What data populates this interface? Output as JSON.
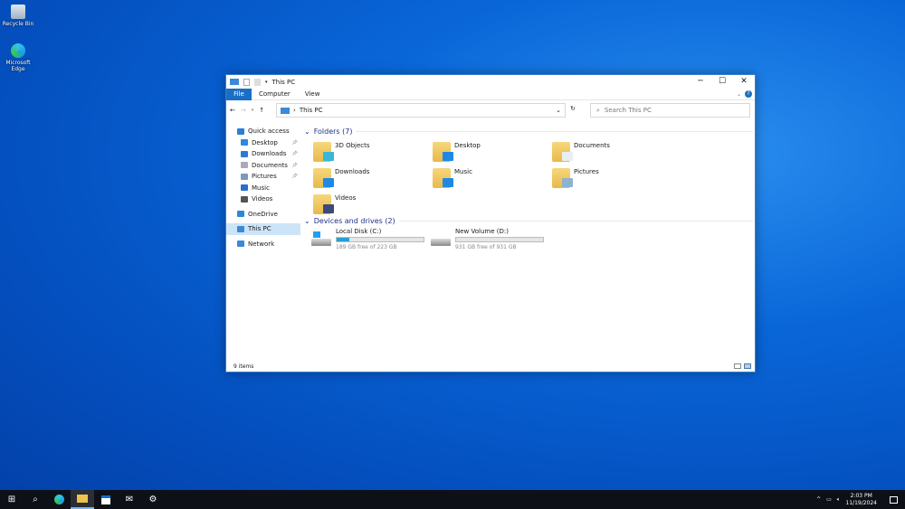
{
  "desktop": {
    "icons": [
      {
        "label": "Recycle Bin",
        "icon": "recycle-bin-icon"
      },
      {
        "label": "Microsoft Edge",
        "icon": "edge-icon"
      }
    ]
  },
  "window": {
    "title": "This PC",
    "controls": {
      "minimize": "─",
      "maximize": "☐",
      "close": "✕"
    },
    "ribbon": {
      "tabs": [
        "File",
        "Computer",
        "View"
      ]
    },
    "address": {
      "path": "This PC",
      "search_placeholder": "Search This PC"
    },
    "nav": {
      "items": [
        {
          "label": "Quick access",
          "color": "#2b7fd4"
        },
        {
          "label": "Desktop",
          "color": "#2a8ae0",
          "pinned": true
        },
        {
          "label": "Downloads",
          "color": "#2a7ad0",
          "pinned": true
        },
        {
          "label": "Documents",
          "color": "#aab",
          "pinned": true
        },
        {
          "label": "Pictures",
          "color": "#7a9ab8",
          "pinned": true
        },
        {
          "label": "Music",
          "color": "#2a6fd0"
        },
        {
          "label": "Videos",
          "color": "#555"
        },
        {
          "label": "OneDrive",
          "color": "#2b88d8"
        },
        {
          "label": "This PC",
          "color": "#3a8ad8",
          "selected": true
        },
        {
          "label": "Network",
          "color": "#3a8ad8"
        }
      ]
    },
    "folders": {
      "heading": "Folders (7)",
      "items": [
        {
          "label": "3D Objects",
          "overlay": "#38b6d8"
        },
        {
          "label": "Desktop",
          "overlay": "#1e88e5"
        },
        {
          "label": "Documents",
          "overlay": "#e8eef4"
        },
        {
          "label": "Downloads",
          "overlay": "#1e88e5"
        },
        {
          "label": "Music",
          "overlay": "#1e88e5"
        },
        {
          "label": "Pictures",
          "overlay": "#8fb3cf"
        },
        {
          "label": "Videos",
          "overlay": "#3b4a7a"
        }
      ]
    },
    "drives": {
      "heading": "Devices and drives (2)",
      "items": [
        {
          "label": "Local Disk (C:)",
          "free": "189 GB free of 223 GB",
          "used_fraction": 0.15
        },
        {
          "label": "New Volume (D:)",
          "free": "931 GB free of 931 GB",
          "used_fraction": 0.0
        }
      ]
    },
    "status": "9 items"
  },
  "taskbar": {
    "time": "2:03 PM",
    "date": "11/19/2024"
  }
}
